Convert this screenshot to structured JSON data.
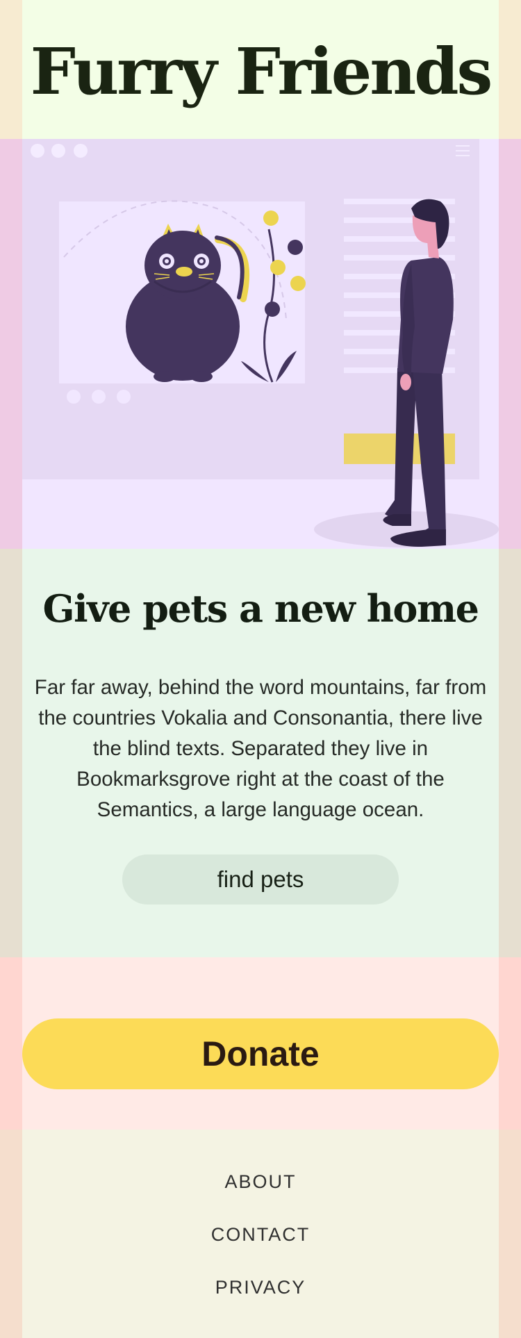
{
  "header": {
    "title": "Furry Friends"
  },
  "hero": {
    "illustration": "person-viewing-cat-painting-illustration"
  },
  "intro": {
    "heading": "Give pets a new home",
    "body": "Far far away, behind the word mountains, far from the countries Vokalia and Consonantia, there live the blind texts. Separated they live in Bookmarksgrove right at the coast of the Semantics, a large language ocean.",
    "button_label": "find pets"
  },
  "donate": {
    "button_label": "Donate"
  },
  "footer": {
    "links": [
      "ABOUT",
      "CONTACT",
      "PRIVACY"
    ]
  },
  "colors": {
    "accent_yellow": "#fcdb57",
    "illustration_purple": "#44355e",
    "heading_dark": "#131d12"
  }
}
